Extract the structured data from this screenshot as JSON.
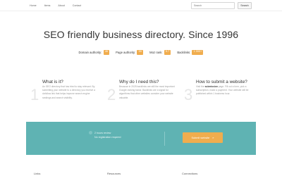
{
  "nav": {
    "links": [
      "Home",
      "Items",
      "About",
      "Contact"
    ],
    "search_placeholder": "Search",
    "search_button": "Search"
  },
  "hero": {
    "title": "SEO friendly business directory. Since 1996"
  },
  "metrics": [
    {
      "label": "Domain authority:",
      "value": "46"
    },
    {
      "label": "Page authority:",
      "value": "59"
    },
    {
      "label": "Moz rank:",
      "value": "5.7"
    },
    {
      "label": "Backlinks:",
      "value": "1 000+"
    }
  ],
  "features": [
    {
      "number": "1",
      "title": "What is it?",
      "text": "An SEO directory that has tried to stay relevant. By submitting your website to a directory you receive a dofollow link that helps improve search engine rankings and search visibility."
    },
    {
      "number": "2",
      "title": "Why do I need this?",
      "text": "Because in 2025 backlinks are still the most important Google ranking factor. Backlinks are a signal for algorithms that other websites consider your website valuable."
    },
    {
      "number": "3",
      "title": "How to submit a website?",
      "text_before": "Visit the",
      "link_text": "submission",
      "text_after": "page. Fill out a form, pick a subscription, make a payment. Your website will be published within 1 business hour."
    }
  ],
  "cta": {
    "line1": "2 hours review",
    "line2": "No registration required",
    "button_label": "Submit website",
    "button_arrow": "»"
  },
  "footer": {
    "headings": [
      "Links",
      "Resources",
      "Connections"
    ]
  },
  "colors": {
    "accent": "#f0ad4e",
    "band": "#5fb3b3"
  }
}
